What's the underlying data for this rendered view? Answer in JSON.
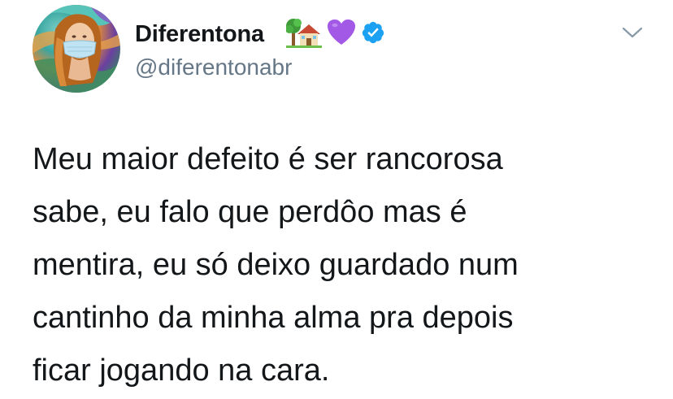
{
  "tweet": {
    "display_name": "Diferentona",
    "handle": "@diferentonabr",
    "name_icons": [
      "house-with-tree-emoji",
      "purple-heart-emoji",
      "verified-badge-icon"
    ],
    "text_lines": [
      "Meu maior defeito é ser rancorosa",
      "sabe, eu falo que perdôo mas é",
      "mentira, eu só deixo guardado num",
      "cantinho da minha alma pra depois",
      "ficar jogando na cara."
    ]
  },
  "colors": {
    "text": "#14171a",
    "secondary": "#657786",
    "verified": "#1da1f2",
    "heart": "#a259e6"
  }
}
